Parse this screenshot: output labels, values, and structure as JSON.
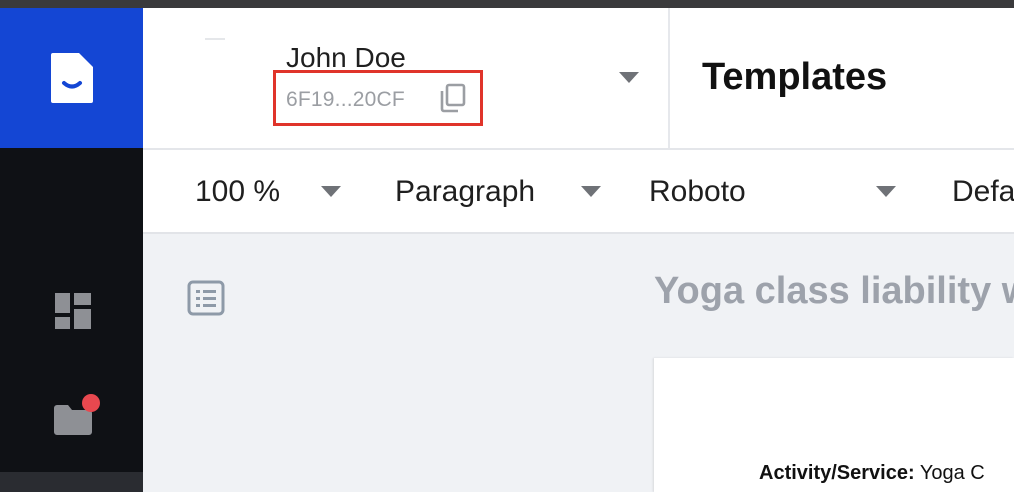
{
  "user": {
    "name": "John Doe",
    "account_id": "6F19...20CF"
  },
  "header": {
    "title": "Templates"
  },
  "toolbar": {
    "zoom": "100 %",
    "paragraph_style": "Paragraph",
    "font": "Roboto",
    "size_partial": "Defa"
  },
  "document": {
    "title": "Yoga class liability w",
    "field_label": "Activity/Service:",
    "field_value": "Yoga C"
  },
  "colors": {
    "brand": "#1446d4",
    "rail": "#0f1115",
    "highlight": "#e0342a",
    "notification": "#e8484f"
  },
  "icons": {
    "logo": "document-smile-icon",
    "dashboard": "dashboard-icon",
    "folder": "folder-icon",
    "copy": "copy-icon",
    "outline": "list-outline-icon",
    "dropdown": "caret-down-icon"
  }
}
